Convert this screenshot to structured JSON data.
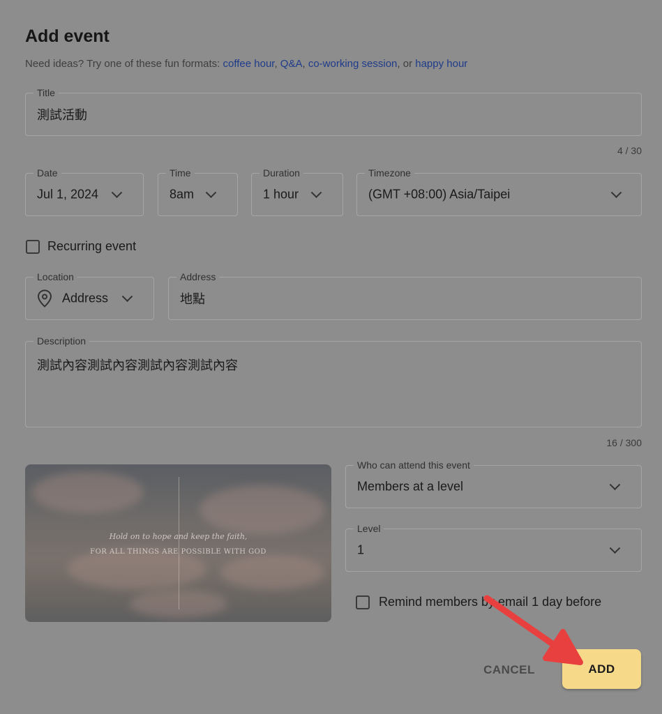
{
  "dialog": {
    "title": "Add event",
    "ideas_prefix": "Need ideas? Try one of these fun formats: ",
    "ideas_links": [
      "coffee hour",
      "Q&A",
      "co-working session",
      "happy hour"
    ],
    "ideas_sep1": ", ",
    "ideas_sep2": ", ",
    "ideas_sep3": ", or "
  },
  "title_field": {
    "label": "Title",
    "value": "測試活動",
    "counter": "4 / 30"
  },
  "date_field": {
    "label": "Date",
    "value": "Jul 1, 2024"
  },
  "time_field": {
    "label": "Time",
    "value": "8am"
  },
  "duration_field": {
    "label": "Duration",
    "value": "1 hour"
  },
  "timezone_field": {
    "label": "Timezone",
    "value": "(GMT +08:00) Asia/Taipei"
  },
  "recurring": {
    "label": "Recurring event",
    "checked": false
  },
  "location_field": {
    "label": "Location",
    "value": "Address",
    "icon": "location-pin-icon"
  },
  "address_field": {
    "label": "Address",
    "value": "地點"
  },
  "description_field": {
    "label": "Description",
    "value": "測試內容測試內容測試內容測試內容",
    "counter": "16 / 300"
  },
  "cover_image": {
    "quote_line1": "Hold on to hope and keep the faith,",
    "quote_line2": "FOR ALL THINGS ARE POSSIBLE WITH GOD"
  },
  "attend_field": {
    "label": "Who can attend this event",
    "value": "Members at a level"
  },
  "level_field": {
    "label": "Level",
    "value": "1"
  },
  "remind": {
    "label": "Remind members by email 1 day before",
    "checked": false
  },
  "actions": {
    "cancel_label": "CANCEL",
    "add_label": "ADD"
  },
  "colors": {
    "overlay": "#8d8d8d",
    "link": "#1f3b8a",
    "add_button": "#f7d98a",
    "annotation_arrow": "#e8403f"
  }
}
